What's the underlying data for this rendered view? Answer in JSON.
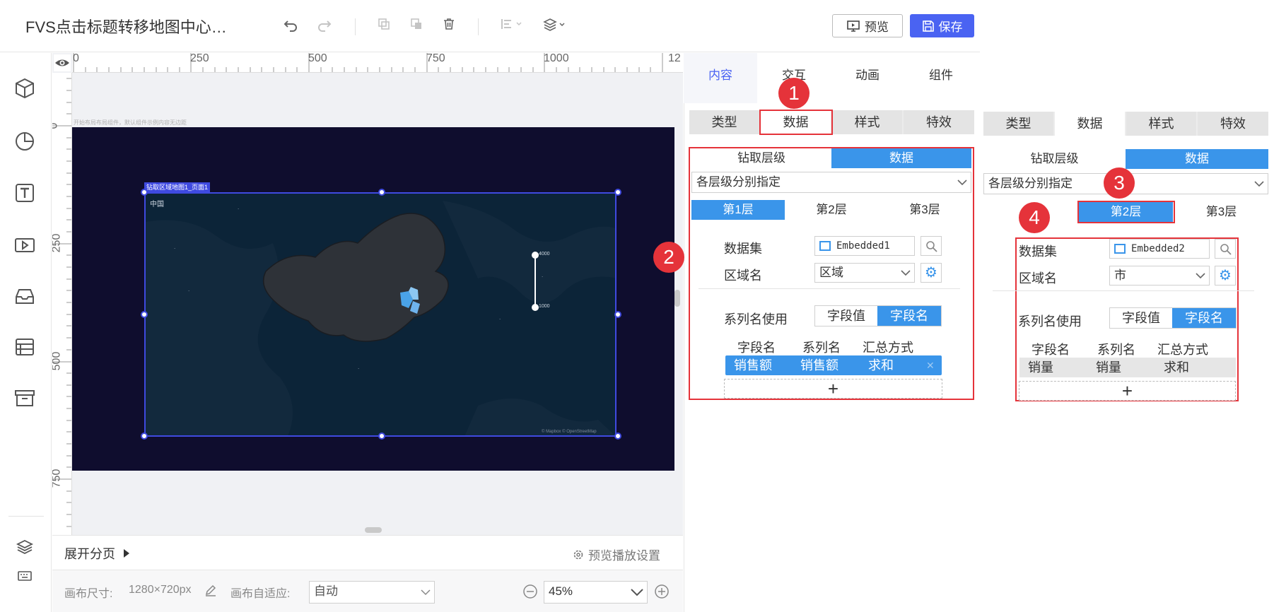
{
  "header": {
    "title": "FVS点击标题转移地图中心…",
    "preview_label": "预览",
    "save_label": "保存"
  },
  "ruler": {
    "top_ticks": [
      "0",
      "250",
      "500",
      "750",
      "1000",
      "12"
    ],
    "left_ticks": [
      "0",
      "250",
      "500",
      "750"
    ]
  },
  "canvas": {
    "hint_text": "开始布局布局组件，默认组件示例内容无边距",
    "widget_label": "钻取区域地图1_页面1",
    "map_title": "中国",
    "legend_max": "4000",
    "legend_min": "1000",
    "attribution": "© Mapbox © OpenStreetMap"
  },
  "pagebar": {
    "expand_label": "展开分页",
    "preview_settings_label": "预览播放设置"
  },
  "statusbar": {
    "canvas_size_label": "画布尺寸:",
    "canvas_size_value": "1280×720px",
    "fit_label": "画布自适应:",
    "fit_value": "自动",
    "zoom_value": "45%"
  },
  "right_panel": {
    "tabs": [
      "内容",
      "交互",
      "动画",
      "组件"
    ],
    "active_tab": "内容"
  },
  "panel1": {
    "subtabs": [
      "类型",
      "数据",
      "样式",
      "特效"
    ],
    "drill_label": "钻取层级",
    "data_label": "数据",
    "mode_value": "各层级分别指定",
    "layers": [
      "第1层",
      "第2层",
      "第3层"
    ],
    "dataset_label": "数据集",
    "dataset_value": "Embedded1",
    "region_label": "区域名",
    "region_value": "区域",
    "series_usage_label": "系列名使用",
    "toggle_value": "字段值",
    "toggle_name": "字段名",
    "col_headers": [
      "字段名",
      "系列名",
      "汇总方式"
    ],
    "row": [
      "销售额",
      "销售额",
      "求和"
    ],
    "add_label": "+"
  },
  "panel2": {
    "subtabs": [
      "类型",
      "数据",
      "样式",
      "特效"
    ],
    "drill_label": "钻取层级",
    "data_label": "数据",
    "mode_value": "各层级分别指定",
    "layers": [
      "第",
      "第2层",
      "第3层"
    ],
    "dataset_label": "数据集",
    "dataset_value": "Embedded2",
    "region_label": "区域名",
    "region_value": "市",
    "series_usage_label": "系列名使用",
    "toggle_value": "字段值",
    "toggle_name": "字段名",
    "col_headers": [
      "字段名",
      "系列名",
      "汇总方式"
    ],
    "row": [
      "销量",
      "销量",
      "求和"
    ],
    "add_label": "+"
  },
  "badges": [
    "1",
    "2",
    "3",
    "4"
  ],
  "colors": {
    "accent": "#4a63f2",
    "selected_blue": "#3a95ea",
    "highlight_red": "#e5333a",
    "stage_bg": "#0f0d2e"
  }
}
